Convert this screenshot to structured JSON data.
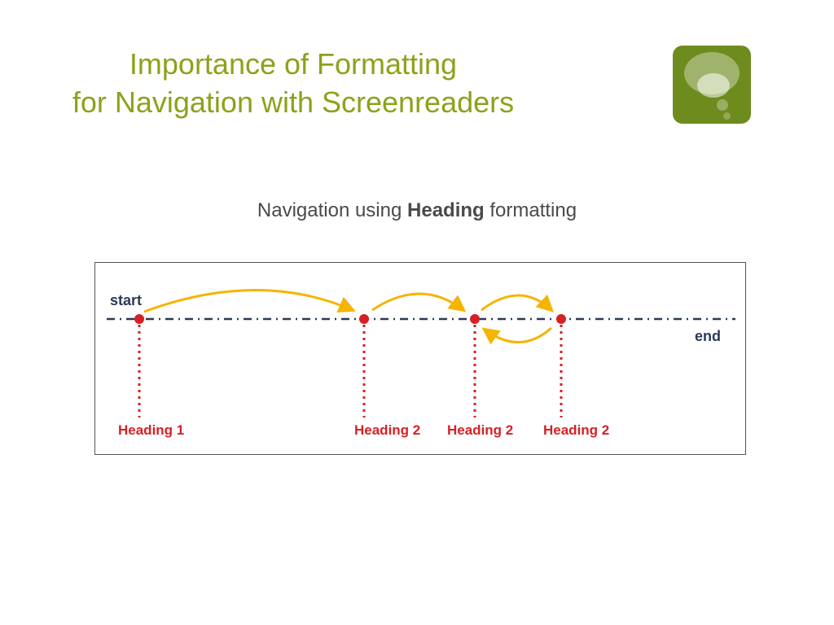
{
  "title_line1": "Importance of Formatting",
  "title_line2": "for Navigation with Screenreaders",
  "subtitle_pre": "Navigation using ",
  "subtitle_bold": "Heading",
  "subtitle_post": " formatting",
  "diagram": {
    "start": "start",
    "end": "end",
    "h1": "Heading 1",
    "h2a": "Heading 2",
    "h2b": "Heading 2",
    "h2c": "Heading 2"
  }
}
